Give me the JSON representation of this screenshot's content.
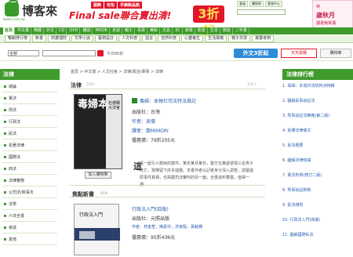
{
  "brand": {
    "name": "博客來",
    "url": "books.com.tw"
  },
  "promo": {
    "top_tags": [
      "服飾",
      "包包",
      "手錶飾品館"
    ],
    "main_text": "Final sale聯合賣出清!",
    "big_number": "3折起"
  },
  "top_links": [
    "會員",
    "購物車",
    "客服中心"
  ],
  "top_ad": {
    "line1": "特",
    "line2": "歲秋月",
    "line3": "讀書簡單讀"
  },
  "main_nav": [
    "首頁",
    "中文書",
    "簡體",
    "外文",
    "CD",
    "DVD",
    "雜誌",
    "MOOK",
    "多語",
    "親子",
    "百貨",
    "美妝",
    "文具",
    "3C",
    "家電",
    "影音",
    "生活",
    "旅遊",
    "二手書"
  ],
  "sub_nav": [
    "暢銷排行榜",
    "新書",
    "商業理財",
    "文學小說",
    "藝術設計",
    "人文科普",
    "語言",
    "自然科普",
    "心靈養生",
    "生活風格",
    "親子共享",
    "專業考用"
  ],
  "search": {
    "category": "全部",
    "placeholder": "",
    "hot": "今日66折"
  },
  "promos": {
    "btn1": "外文3折起",
    "btn2": "天天搶購",
    "cart": "購物車"
  },
  "left_panel": {
    "title": "法律",
    "items": [
      "總論",
      "憲法",
      "刑法",
      "行政法",
      "民法",
      "名著法律",
      "國際法",
      "商法",
      "法律實務",
      "公司法/商事法",
      "法學",
      "六法全書",
      "考試",
      "其他"
    ]
  },
  "breadcrumb": "首頁 > 中文書 > 人文社會 > 法律/政治/軍事 > 法律",
  "product": {
    "section_title": "法律",
    "section_sub": "TOP1",
    "right_note": "TOP 1",
    "cover_title": "毒婦本性",
    "cover_stripe": "杜德爾大法官",
    "preview_label": "加入購物車",
    "title": "毒婦：本報社司法特派員記",
    "author": "作者：吳傑",
    "publisher": "出版社：台灣",
    "translator": "譯者：鄭MIMORI",
    "price": "優惠價：79折205元",
    "excerpt_big": "這",
    "excerpt": "是一起引人側目的案件。某年某月某日，警方在某處發現三名男子死亡，現場留下許多謎團。本書作者以記者身分深入調查，試圖還原事件真相，也揭露司法審判的另一面，全書資料豐富，值得一讀。"
  },
  "new_books": {
    "title": "焦點新書",
    "sub": "NEW",
    "cover_title": "行政法入門",
    "book_title": "行政法入門(四版)",
    "publisher": "出版社：元照出版",
    "authors": "作者：林金莖，陳嘉中，洪家殷，黃銘輝",
    "price": "優惠價：95折436元"
  },
  "ranking": {
    "header": "法律排行榜",
    "items": [
      "1. 毒婦：本週日法院判決特輯",
      "2. 圖解民事訴訟法",
      "3. 刑事訴訟法精義(第二版)",
      "4. 看懂法律條文",
      "5. 民法概要",
      "6. 圖解法律知識",
      "7. 憲法判例(修訂二版)",
      "8. 刑事訴訟新制",
      "9. 民法總則",
      "10. 行政法入門(四版)",
      "11. 圖解國際私法"
    ]
  }
}
